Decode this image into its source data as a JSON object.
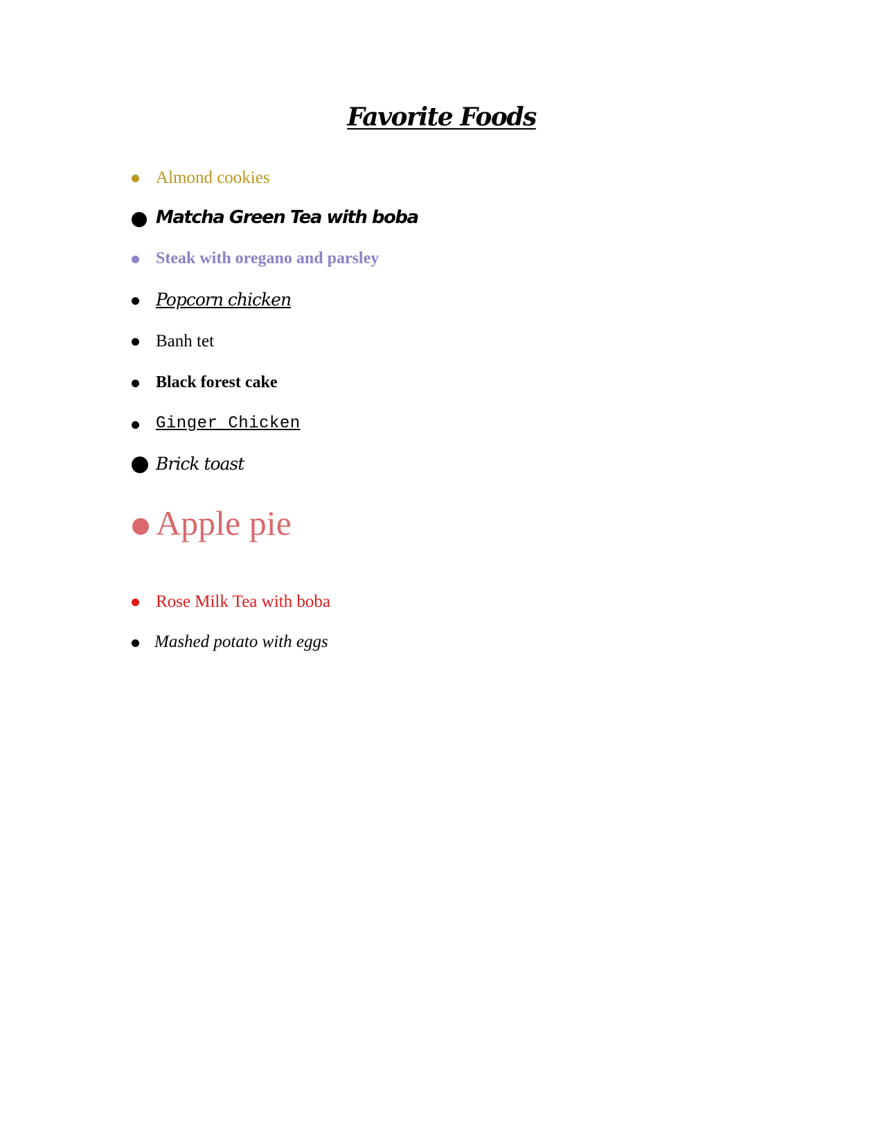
{
  "document": {
    "title": "Favorite Foods",
    "items": [
      {
        "label": "Almond cookies",
        "color": "#b8961f"
      },
      {
        "label": "Matcha Green Tea with boba",
        "color": "#000000"
      },
      {
        "label": "Steak with oregano and parsley",
        "color": "#8b82c8"
      },
      {
        "label": "Popcorn chicken",
        "color": "#000000"
      },
      {
        "label": "Banh tet",
        "color": "#000000"
      },
      {
        "label": "Black forest cake",
        "color": "#000000"
      },
      {
        "label": "Ginger Chicken",
        "color": "#000000"
      },
      {
        "label": "Brick toast",
        "color": "#000000"
      },
      {
        "label": "Apple pie",
        "color": "#d9696c"
      },
      {
        "label": "Rose Milk Tea with boba",
        "color": "#e01a1a"
      },
      {
        "label": "Mashed potato with eggs",
        "color": "#000000"
      }
    ]
  }
}
